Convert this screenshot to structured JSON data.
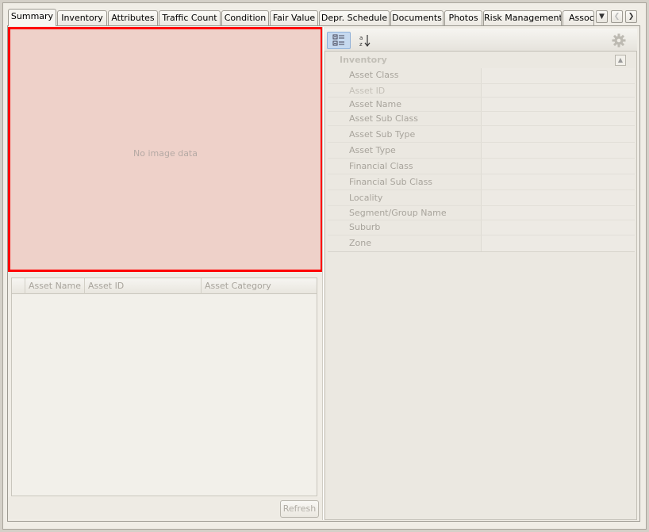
{
  "tabs": [
    {
      "label": "Summary",
      "active": true
    },
    {
      "label": "Inventory"
    },
    {
      "label": "Attributes"
    },
    {
      "label": "Traffic Count"
    },
    {
      "label": "Condition"
    },
    {
      "label": "Fair Value"
    },
    {
      "label": "Depr. Schedule"
    },
    {
      "label": "Documents"
    },
    {
      "label": "Photos"
    },
    {
      "label": "Risk Management"
    },
    {
      "label": "Associ"
    }
  ],
  "image_panel": {
    "placeholder": "No image data"
  },
  "grid": {
    "columns": [
      "Asset Name",
      "Asset ID",
      "Asset Category"
    ]
  },
  "refresh_label": "Refresh",
  "property_section": {
    "title": "Inventory",
    "rows": [
      {
        "label": "Asset Class",
        "value": ""
      },
      {
        "label": "Asset ID",
        "value": ""
      },
      {
        "label": "Asset Name",
        "value": ""
      },
      {
        "label": "Asset Sub Class",
        "value": ""
      },
      {
        "label": "Asset Sub Type",
        "value": ""
      },
      {
        "label": "Asset Type",
        "value": ""
      },
      {
        "label": "Financial Class",
        "value": ""
      },
      {
        "label": "Financial Sub Class",
        "value": ""
      },
      {
        "label": "Locality",
        "value": ""
      },
      {
        "label": "Segment/Group Name",
        "value": ""
      },
      {
        "label": "Suburb",
        "value": ""
      },
      {
        "label": "Zone",
        "value": ""
      }
    ]
  },
  "colors": {
    "highlight_border": "#ff0000",
    "image_bg": "#eed1c9"
  },
  "icons": [
    "chevron-down-icon",
    "chevron-left-icon",
    "chevron-right-icon",
    "categorized-view-icon",
    "sort-alphabetical-icon",
    "gear-icon",
    "collapse-up-icon"
  ]
}
